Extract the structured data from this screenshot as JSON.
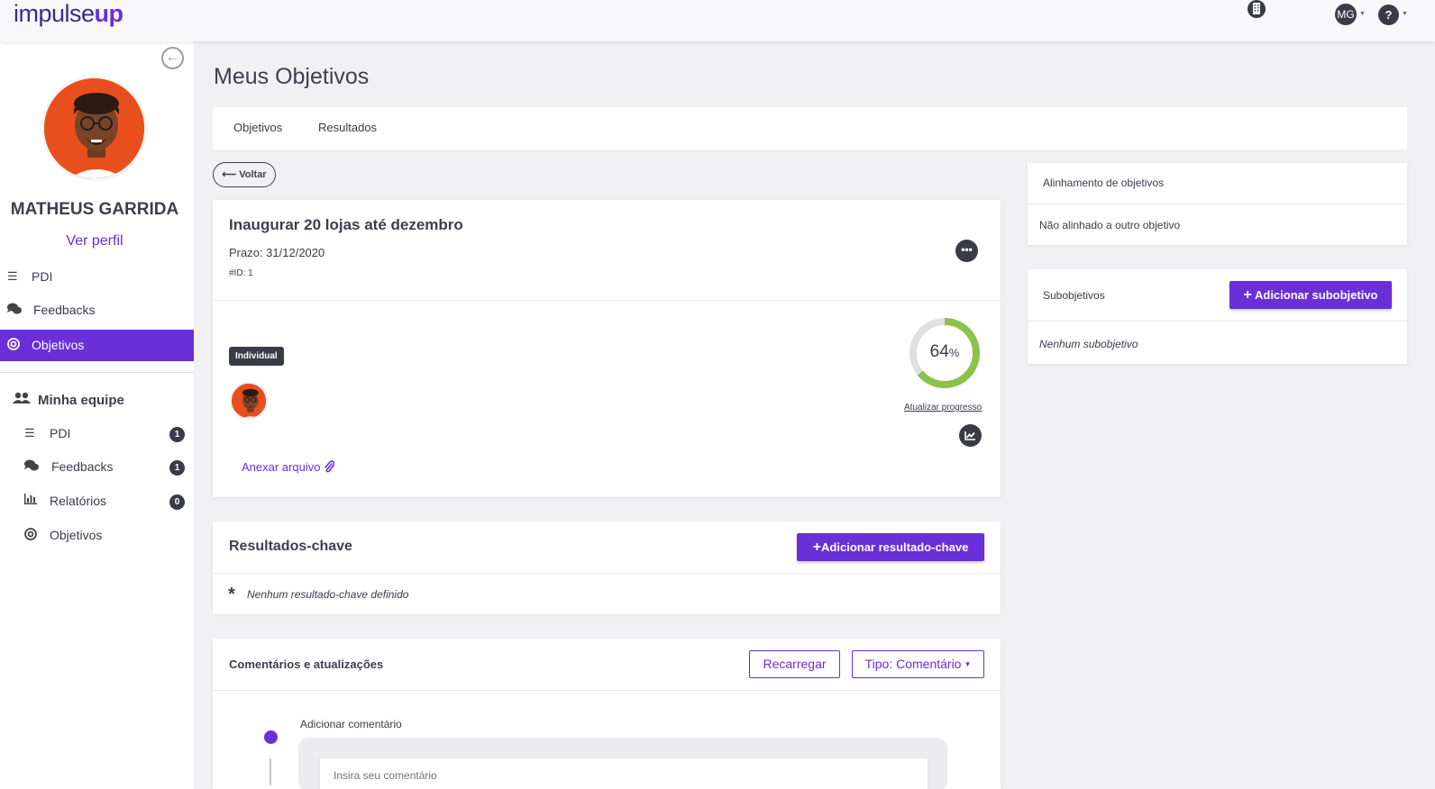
{
  "app": {
    "logo_main": "impulse",
    "logo_accent": "up"
  },
  "topbar": {
    "user_initials": "MG",
    "help_label": "?"
  },
  "sidebar": {
    "user_name": "MATHEUS GARRIDA",
    "profile_link": "Ver perfil",
    "items": [
      {
        "label": "PDI",
        "icon": "list-icon",
        "active": false
      },
      {
        "label": "Feedbacks",
        "icon": "comments-icon",
        "active": false
      },
      {
        "label": "Objetivos",
        "icon": "target-icon",
        "active": true
      }
    ],
    "team": {
      "title": "Minha equipe",
      "items": [
        {
          "label": "PDI",
          "icon": "list-icon",
          "badge": "1"
        },
        {
          "label": "Feedbacks",
          "icon": "comments-icon",
          "badge": "1"
        },
        {
          "label": "Relatórios",
          "icon": "bar-chart-icon",
          "badge": "0"
        },
        {
          "label": "Objetivos",
          "icon": "target-icon",
          "badge": ""
        }
      ]
    }
  },
  "main": {
    "title": "Meus Objetivos",
    "tabs": [
      {
        "label": "Objetivos"
      },
      {
        "label": "Resultados"
      }
    ],
    "back_label": "Voltar",
    "objective": {
      "title": "Inaugurar 20 lojas até dezembro",
      "deadline": "Prazo: 31/12/2020",
      "id": "#ID: 1",
      "type_tag": "Individual",
      "progress_value": "64",
      "progress_unit": "%",
      "progress_fraction": 0.64,
      "update_progress": "Atualizar progresso",
      "attach_file": "Anexar arquivo"
    },
    "key_results": {
      "title": "Resultados-chave",
      "add_button": "Adicionar resultado-chave",
      "empty": "Nenhum resultado-chave definido"
    },
    "comments": {
      "title": "Comentários e atualizações",
      "reload_button": "Recarregar",
      "type_button": "Tipo: Comentário",
      "add_label": "Adicionar comentário",
      "input_placeholder": "Insira seu comentário"
    }
  },
  "right": {
    "alignment": {
      "title": "Alinhamento de objetivos",
      "value": "Não alinhado a outro objetivo"
    },
    "subobjectives": {
      "title": "Subobjetivos",
      "add_button": "Adicionar subobjetivo",
      "empty": "Nenhum subobjetivo"
    }
  },
  "colors": {
    "brand": "#6a2fd6",
    "progress": "#8bc34a",
    "progress_track": "#e0e0e0",
    "dark": "#3a3b47",
    "avatar_bg": "#e94f1d"
  }
}
